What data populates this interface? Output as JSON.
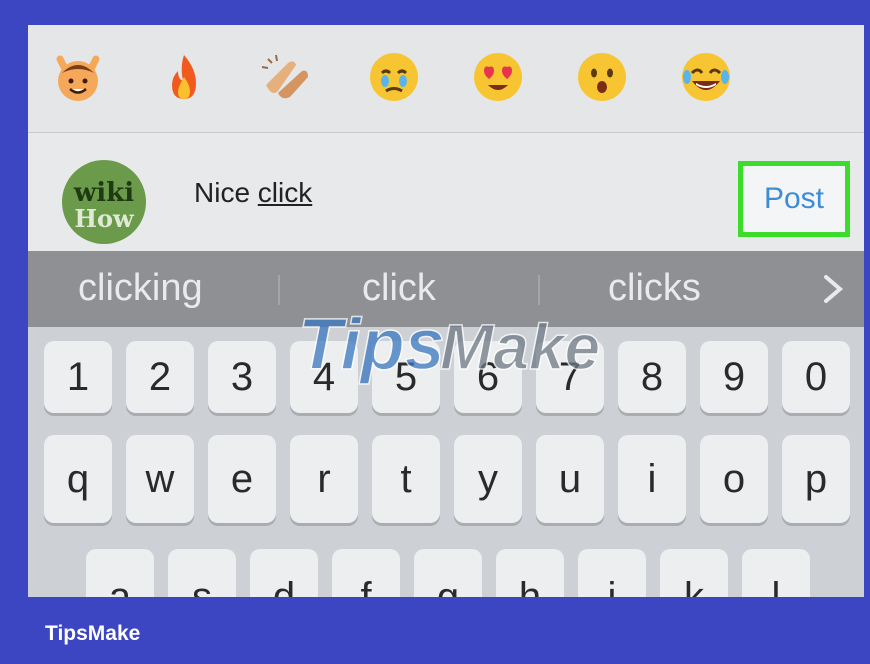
{
  "emoji_bar": {
    "emojis": [
      "raising-hands-face-emoji",
      "fire-emoji",
      "clapping-hands-emoji",
      "crying-face-emoji",
      "heart-eyes-emoji",
      "surprised-face-emoji",
      "tears-of-joy-emoji"
    ]
  },
  "comment": {
    "avatar_line1": "wiki",
    "avatar_line2": "How",
    "text_plain": "Nice ",
    "text_underlined": "click",
    "post_label": "Post",
    "highlight_color": "#3bdc2a",
    "link_color": "#3b8ed6"
  },
  "suggestions": [
    "clicking",
    "click",
    "clicks"
  ],
  "keyboard": {
    "number_row": [
      "1",
      "2",
      "3",
      "4",
      "5",
      "6",
      "7",
      "8",
      "9",
      "0"
    ],
    "top_row": [
      "q",
      "w",
      "e",
      "r",
      "t",
      "y",
      "u",
      "i",
      "o",
      "p"
    ],
    "home_row": [
      "a",
      "s",
      "d",
      "f",
      "g",
      "h",
      "j",
      "k",
      "l"
    ]
  },
  "watermark": "TipsMake",
  "footer_brand": "TipsMake"
}
